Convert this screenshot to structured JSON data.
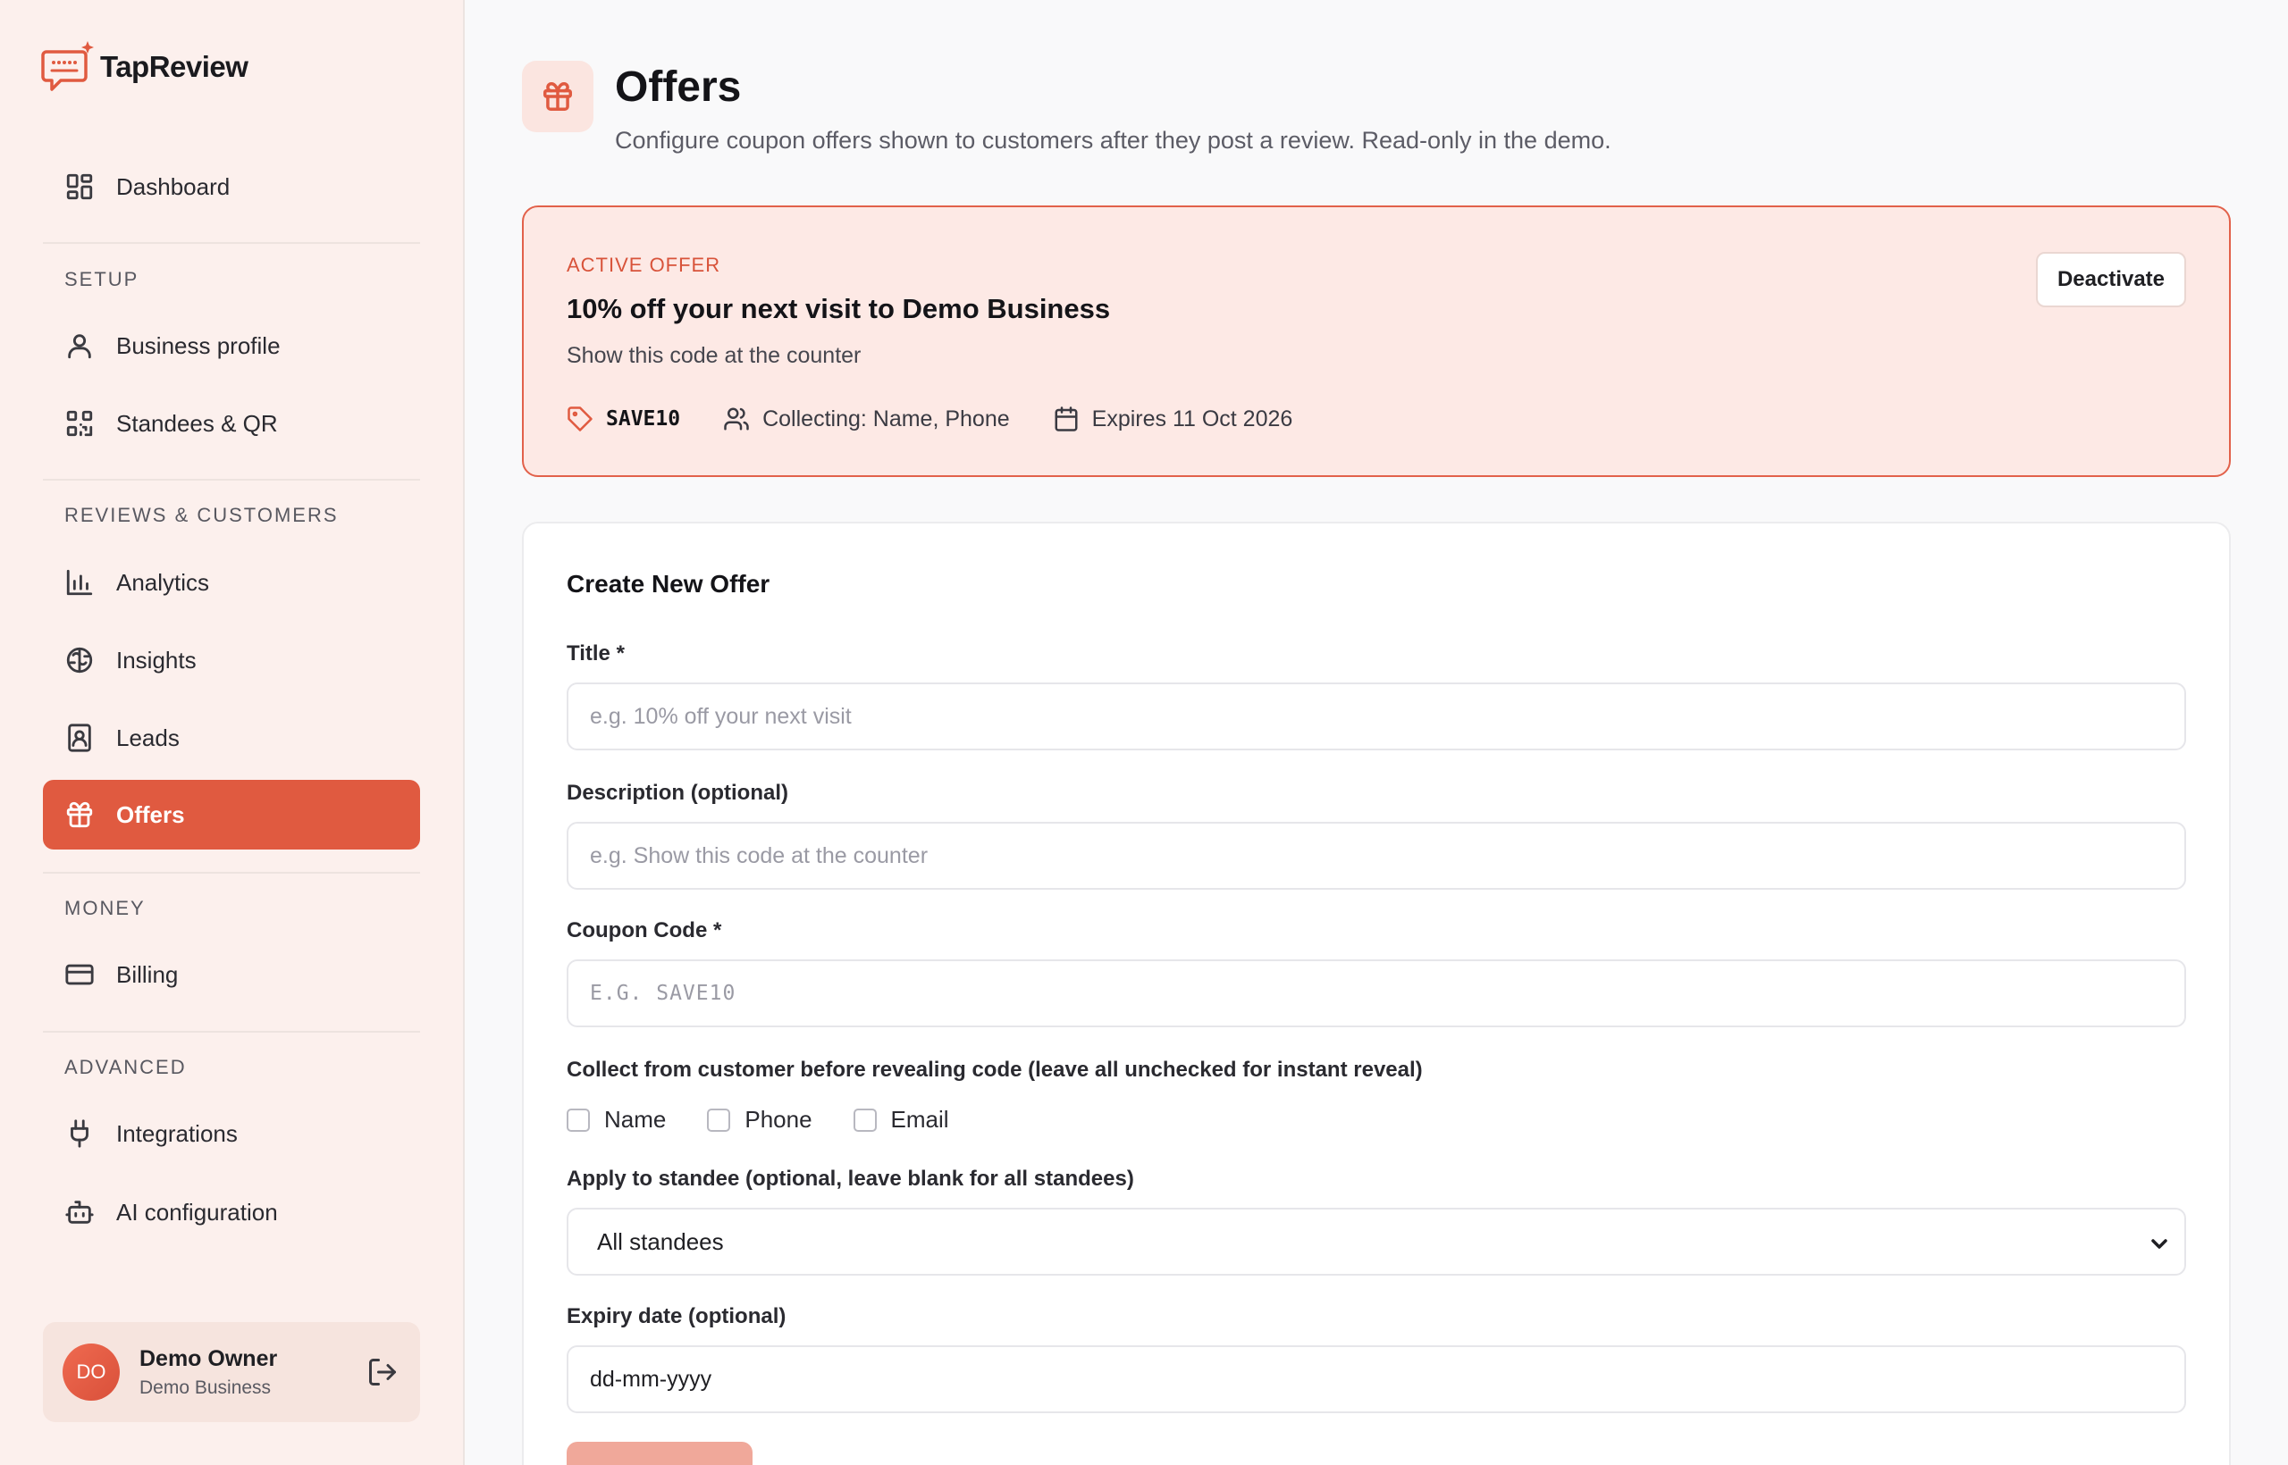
{
  "brand": {
    "name": "TapReview",
    "accent": "#e05a40"
  },
  "sidebar": {
    "dashboard": "Dashboard",
    "sections": {
      "setup": "SETUP",
      "reviews": "REVIEWS & CUSTOMERS",
      "money": "MONEY",
      "advanced": "ADVANCED"
    },
    "items": {
      "business_profile": "Business profile",
      "standees": "Standees & QR",
      "analytics": "Analytics",
      "insights": "Insights",
      "leads": "Leads",
      "offers": "Offers",
      "billing": "Billing",
      "integrations": "Integrations",
      "ai_config": "AI configuration"
    },
    "user": {
      "initials": "DO",
      "name": "Demo Owner",
      "business": "Demo Business"
    }
  },
  "header": {
    "title": "Offers",
    "subtitle": "Configure coupon offers shown to customers after they post a review. Read-only in the demo."
  },
  "active_offer": {
    "label": "ACTIVE OFFER",
    "title": "10% off your next visit to Demo Business",
    "description": "Show this code at the counter",
    "code": "SAVE10",
    "collecting": "Collecting: Name, Phone",
    "expires": "Expires 11 Oct 2026",
    "deactivate_label": "Deactivate"
  },
  "form": {
    "title": "Create New Offer",
    "title_label": "Title *",
    "title_placeholder": "e.g. 10% off your next visit",
    "description_label": "Description (optional)",
    "description_placeholder": "e.g. Show this code at the counter",
    "coupon_label": "Coupon Code *",
    "coupon_placeholder": "E.G. SAVE10",
    "collect_label": "Collect from customer before revealing code (leave all unchecked for instant reveal)",
    "collect_options": [
      "Name",
      "Phone",
      "Email"
    ],
    "standee_label": "Apply to standee (optional, leave blank for all standees)",
    "standee_value": "All standees",
    "expiry_label": "Expiry date (optional)",
    "expiry_value": "dd-mm-yyyy"
  }
}
